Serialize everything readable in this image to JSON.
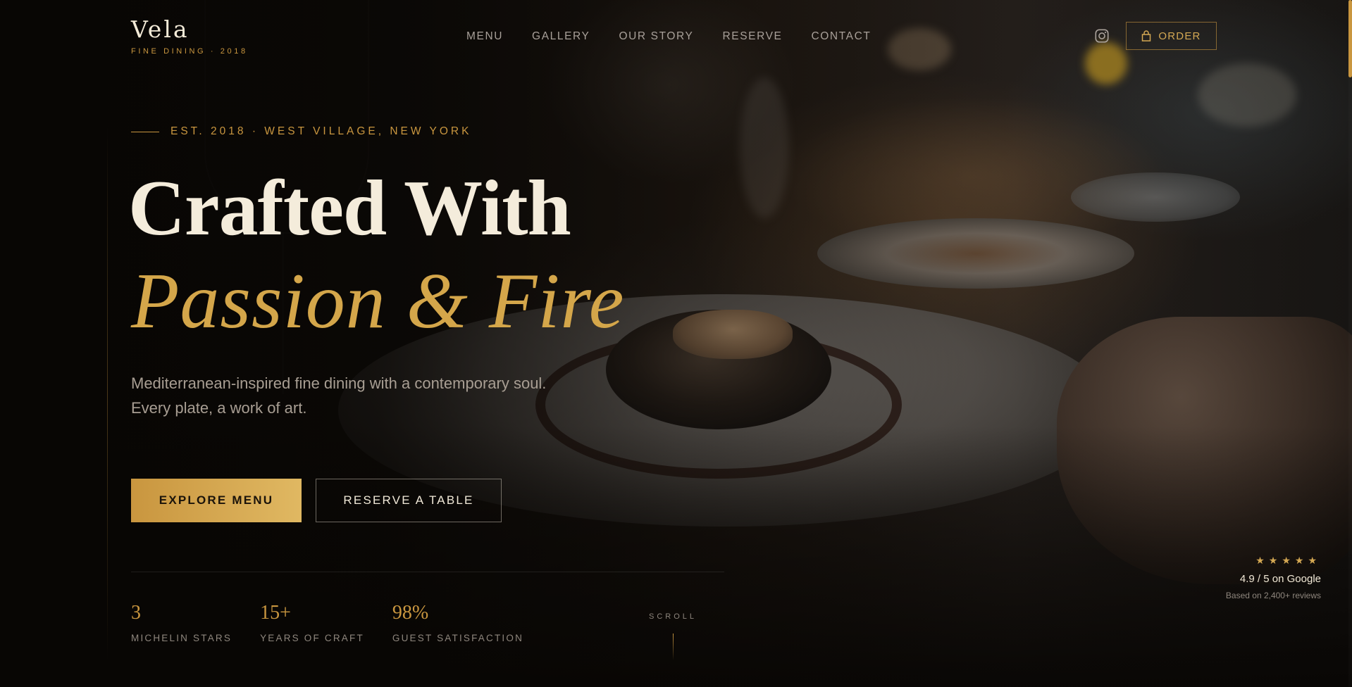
{
  "brand": {
    "name": "Vela",
    "tagline": "FINE DINING · 2018"
  },
  "nav": {
    "items": [
      {
        "label": "MENU"
      },
      {
        "label": "GALLERY"
      },
      {
        "label": "OUR STORY"
      },
      {
        "label": "RESERVE"
      },
      {
        "label": "CONTACT"
      }
    ]
  },
  "header": {
    "order_label": "ORDER",
    "social_icon": "instagram-icon",
    "order_icon": "shopping-bag-icon"
  },
  "hero": {
    "eyebrow": "EST. 2018 · WEST VILLAGE, NEW YORK",
    "title_line1": "Crafted With",
    "title_line2": "Passion & Fire",
    "subtitle_line1": "Mediterranean-inspired fine dining with a contemporary soul.",
    "subtitle_line2": "Every plate, a work of art.",
    "primary_cta": "EXPLORE MENU",
    "secondary_cta": "RESERVE A TABLE"
  },
  "stats": [
    {
      "value": "3",
      "label": "MICHELIN STARS"
    },
    {
      "value": "15+",
      "label": "YEARS OF CRAFT"
    },
    {
      "value": "98%",
      "label": "GUEST SATISFACTION"
    }
  ],
  "scroll_label": "SCROLL",
  "rating": {
    "stars": "★★★★★",
    "score_text": "4.9 / 5 on Google",
    "reviews_text": "Based on 2,400+ reviews",
    "star_count": 5
  },
  "colors": {
    "accent": "#c9963f",
    "accent_light": "#e0b862",
    "background": "#0b0907",
    "headline": "#f4ecdb",
    "muted": "#a89e93"
  }
}
